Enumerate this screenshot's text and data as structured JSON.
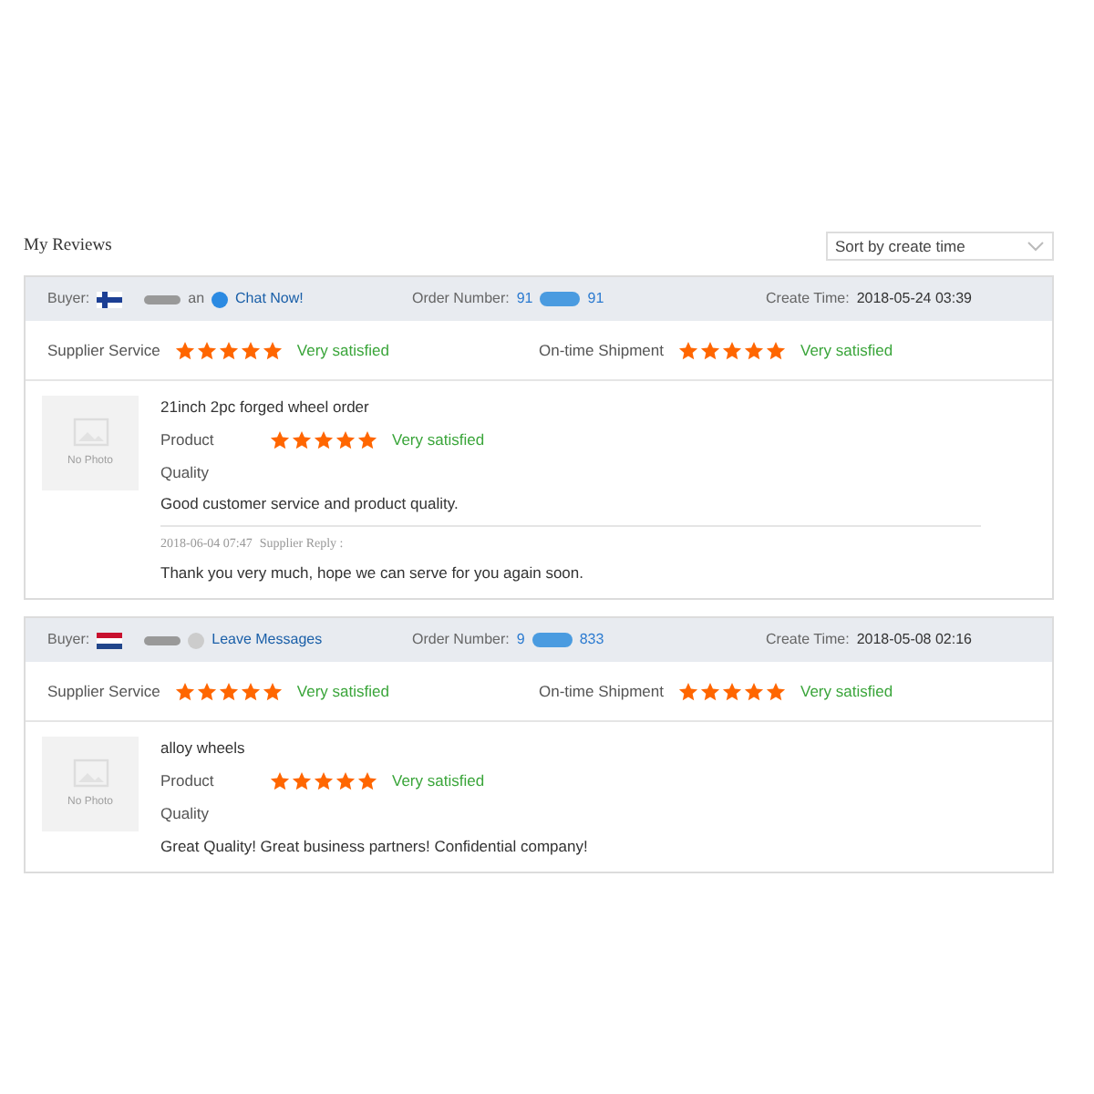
{
  "title": "My Reviews",
  "sort": {
    "value": "Sort by create time"
  },
  "reviews": [
    {
      "buyer_label": "Buyer:",
      "kind": "finland",
      "buyer_name_end": "an",
      "contact": {
        "label": "Chat Now!",
        "online": true
      },
      "order_label": "Order Number:",
      "order_start": "91",
      "order_end": "91",
      "time_label": "Create Time:",
      "time": "2018-05-24 03:39",
      "ratings": [
        {
          "label": "Supplier Service",
          "stars": 5,
          "verdict": "Very satisfied"
        },
        {
          "label": "On-time Shipment",
          "stars": 5,
          "verdict": "Very satisfied"
        }
      ],
      "photo_label": "No Photo",
      "product_name": "21inch 2pc forged wheel order",
      "product_label": "Product",
      "product_rating": {
        "stars": 5
      },
      "product_verdict": "Very satisfied",
      "quality_label": "Quality",
      "comment": "Good customer service and product quality.",
      "reply": {
        "time": "2018-06-04 07:47",
        "label": "Supplier Reply :",
        "text": "Thank you very much, hope we can serve for you again soon."
      }
    },
    {
      "buyer_label": "Buyer:",
      "kind": "netherlands",
      "contact": {
        "label": "Leave Messages",
        "online": false
      },
      "order_label": "Order Number:",
      "order_start": "9",
      "order_end": "833",
      "time_label": "Create Time:",
      "time": "2018-05-08 02:16",
      "ratings": [
        {
          "label": "Supplier Service",
          "stars": 5,
          "verdict": "Very satisfied"
        },
        {
          "label": "On-time Shipment",
          "stars": 5,
          "verdict": "Very satisfied"
        }
      ],
      "photo_label": "No Photo",
      "product_name": "alloy wheels",
      "product_label": "Product",
      "product_rating": {
        "stars": 5
      },
      "product_verdict": "Very satisfied",
      "quality_label": "Quality",
      "comment": "Great Quality! Great business partners! Confidential company!"
    }
  ]
}
